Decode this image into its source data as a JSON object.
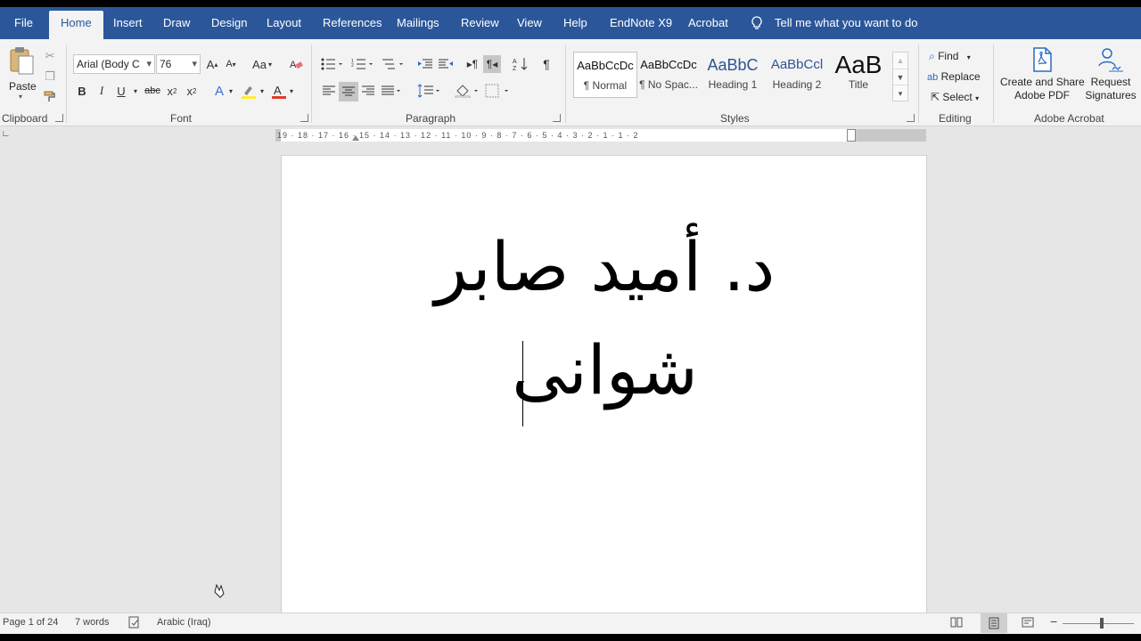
{
  "tabs": [
    {
      "label": "File"
    },
    {
      "label": "Home"
    },
    {
      "label": "Insert"
    },
    {
      "label": "Draw"
    },
    {
      "label": "Design"
    },
    {
      "label": "Layout"
    },
    {
      "label": "References"
    },
    {
      "label": "Mailings"
    },
    {
      "label": "Review"
    },
    {
      "label": "View"
    },
    {
      "label": "Help"
    },
    {
      "label": "EndNote X9"
    },
    {
      "label": "Acrobat"
    }
  ],
  "tellme": "Tell me what you want to do",
  "clipboard": {
    "paste_label": "Paste",
    "group_label": "Clipboard"
  },
  "font": {
    "name": "Arial (Body C",
    "size": "76",
    "group_label": "Font",
    "case_label": "Aa",
    "font_color": "#e03a2f",
    "highlight_color": "#ffeb3b"
  },
  "paragraph": {
    "group_label": "Paragraph"
  },
  "styles": {
    "group_label": "Styles",
    "items": [
      {
        "preview": "AaBbCcDc",
        "name": "¶ Normal"
      },
      {
        "preview": "AaBbCcDc",
        "name": "¶ No Spac..."
      },
      {
        "preview": "AaBbC",
        "name": "Heading 1"
      },
      {
        "preview": "AaBbCcl",
        "name": "Heading 2"
      },
      {
        "preview": "AaB",
        "name": "Title"
      }
    ]
  },
  "editing": {
    "find": "Find",
    "replace": "Replace",
    "select": "Select",
    "group_label": "Editing"
  },
  "acrobat": {
    "create": "Create and Share",
    "create2": "Adobe PDF",
    "request": "Request",
    "request2": "Signatures",
    "group_label": "Adobe Acrobat"
  },
  "ruler": {
    "numbers": "19 · 18 · 17 · 16 · 15 · 14 · 13 · 12 · 11 · 10 · 9 · 8 · 7 · 6 · 5 · 4 · 3 · 2 · 1 · 1 · 2"
  },
  "document": {
    "line1": "د. أميد صابر",
    "line2": "شوانى"
  },
  "status": {
    "page": "Page 1 of 24",
    "words": "7 words",
    "language": "Arabic (Iraq)"
  },
  "colors": {
    "accent": "#2b579a"
  }
}
